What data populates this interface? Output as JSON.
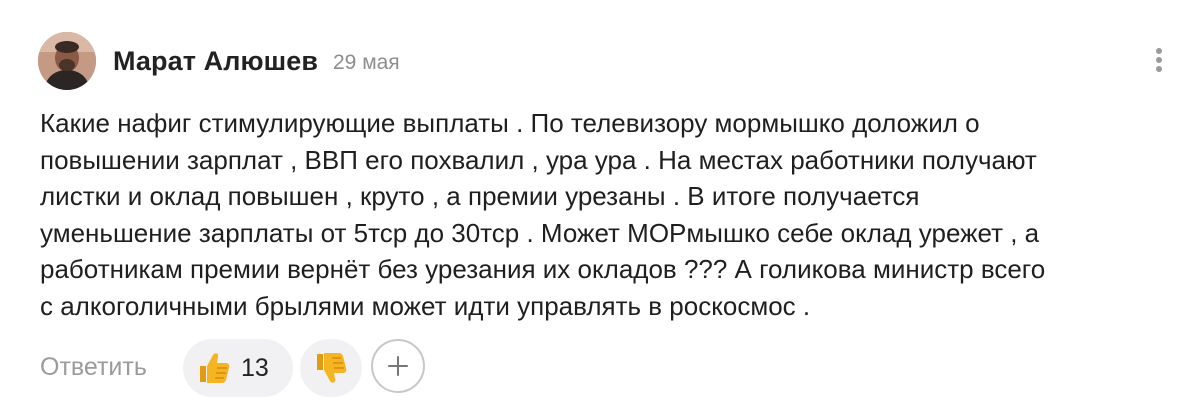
{
  "comment": {
    "author": "Марат Алюшев",
    "date": "29 мая",
    "text_lines": [
      "Какие нафиг стимулирующие выплаты . По телевизору мормышко доложил о",
      "повышении зарплат , ВВП его похвалил , ура ура . На местах работники получают",
      "листки и оклад повышен , круто , а премии урезаны . В итоге получается",
      "уменьшение зарплаты от 5тср до 30тср . Может МОРмышко себе оклад урежет , а",
      "работникам премии вернёт без урезания их окладов ??? А голикова министр всего",
      "с алкоголичными брылями может идти управлять в роскосмос ."
    ]
  },
  "actions": {
    "reply_label": "Ответить",
    "like_count": "13",
    "like_icon": "thumbs-up-emoji",
    "dislike_icon": "thumbs-down-emoji",
    "add_reaction_icon": "plus-icon",
    "more_icon": "vertical-dots-icon"
  },
  "colors": {
    "text": "#1f1f1f",
    "muted": "#9b9b9b",
    "pill_background": "#f1f1f3",
    "emoji_yellow": "#f5b422"
  }
}
